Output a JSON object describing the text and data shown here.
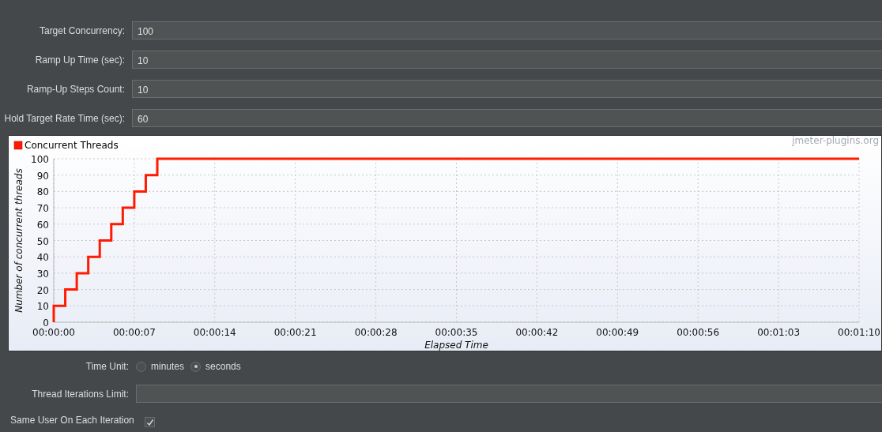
{
  "fields": [
    {
      "label": "Target Concurrency:",
      "value": "100"
    },
    {
      "label": "Ramp Up Time (sec):",
      "value": "10"
    },
    {
      "label": "Ramp-Up Steps Count:",
      "value": "10"
    },
    {
      "label": "Hold Target Rate Time (sec):",
      "value": "60"
    }
  ],
  "chart": {
    "watermark": "jmeter-plugins.org",
    "chart_data": {
      "type": "line",
      "xlabel": "Elapsed Time",
      "ylabel": "Number of concurrent threads",
      "x": [
        0,
        0,
        1,
        1,
        2,
        2,
        3,
        3,
        4,
        4,
        5,
        5,
        6,
        6,
        7,
        7,
        8,
        8,
        9,
        9,
        70
      ],
      "series": [
        {
          "name": "Concurrent Threads",
          "color": "#ff1a00",
          "values": [
            0,
            10,
            10,
            20,
            20,
            30,
            30,
            40,
            40,
            50,
            50,
            60,
            60,
            70,
            70,
            80,
            80,
            90,
            90,
            100,
            100
          ]
        }
      ],
      "xlim": [
        0,
        70
      ],
      "ylim": [
        0,
        100
      ],
      "xticks": [
        {
          "value": 0,
          "label": "00:00:00"
        },
        {
          "value": 7,
          "label": "00:00:07"
        },
        {
          "value": 14,
          "label": "00:00:14"
        },
        {
          "value": 21,
          "label": "00:00:21"
        },
        {
          "value": 28,
          "label": "00:00:28"
        },
        {
          "value": 35,
          "label": "00:00:35"
        },
        {
          "value": 42,
          "label": "00:00:42"
        },
        {
          "value": 49,
          "label": "00:00:49"
        },
        {
          "value": 56,
          "label": "00:00:56"
        },
        {
          "value": 63,
          "label": "00:01:03"
        },
        {
          "value": 70,
          "label": "00:01:10"
        }
      ],
      "yticks": [
        0,
        10,
        20,
        30,
        40,
        50,
        60,
        70,
        80,
        90,
        100
      ],
      "grid": true
    }
  },
  "time_unit": {
    "label": "Time Unit:",
    "options": [
      {
        "label": "minutes",
        "selected": false
      },
      {
        "label": "seconds",
        "selected": true
      }
    ]
  },
  "iterations_limit": {
    "label": "Thread Iterations Limit:"
  },
  "same_user": {
    "label": "Same User On Each Iteration",
    "checked": true
  }
}
